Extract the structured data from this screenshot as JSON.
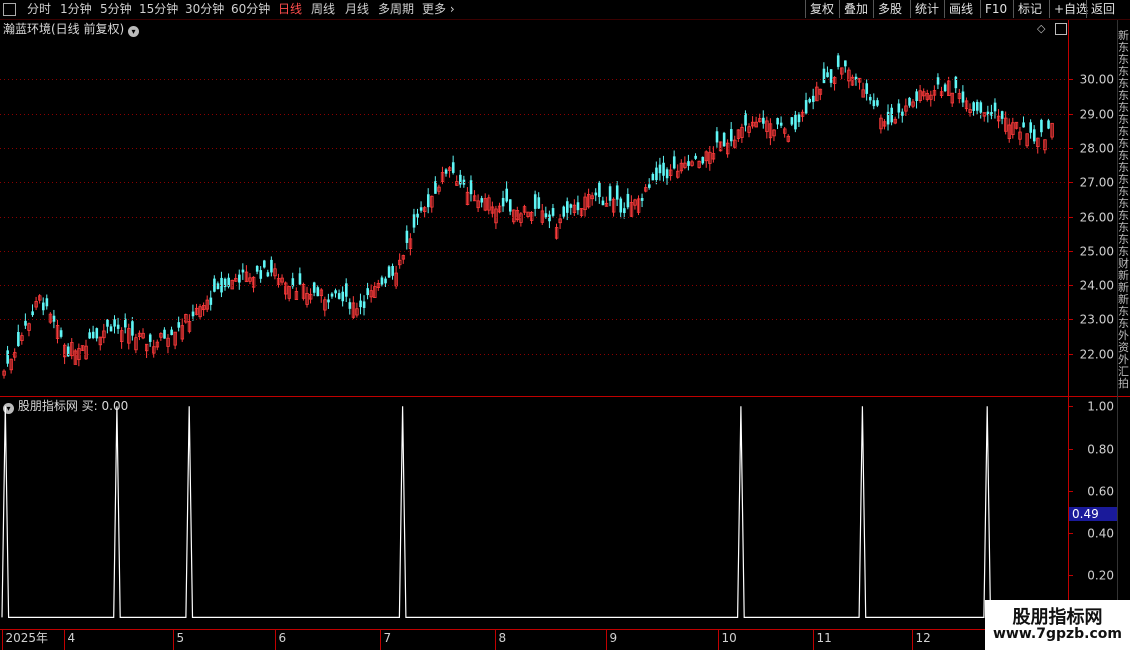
{
  "toolbar": {
    "periods": [
      {
        "label": "分时",
        "active": false
      },
      {
        "label": "1分钟",
        "active": false
      },
      {
        "label": "5分钟",
        "active": false
      },
      {
        "label": "15分钟",
        "active": false
      },
      {
        "label": "30分钟",
        "active": false
      },
      {
        "label": "60分钟",
        "active": false
      },
      {
        "label": "日线",
        "active": true
      },
      {
        "label": "周线",
        "active": false
      },
      {
        "label": "月线",
        "active": false
      },
      {
        "label": "多周期",
        "active": false
      },
      {
        "label": "更多",
        "active": false
      }
    ],
    "actions": [
      "复权",
      "叠加",
      "多股",
      "统计",
      "画线",
      "F10",
      "标记",
      "+自选",
      "返回"
    ]
  },
  "main_title": "瀚蓝环境(日线 前复权)",
  "indicator_title": "股朋指标网 买: 0.00",
  "side_glyphs": "新东东东东东东东东东东东东东东东东东东财新新新东东外资外汇拍",
  "watermark": {
    "line1": "股朋指标网",
    "line2": "www.7gpzb.com"
  },
  "colors": {
    "up": "#ff3b3b",
    "down": "#5ff5f5",
    "grid": "#8b0000",
    "axis": "#c00000",
    "indicator": "#ffffff",
    "cursor_box": "#1a1a9a"
  },
  "chart_data": [
    {
      "type": "candlestick",
      "title": "瀚蓝环境(日线 前复权)",
      "y_ticks": [
        30.0,
        29.0,
        28.0,
        27.0,
        26.0,
        25.0,
        24.0,
        23.0,
        22.0
      ],
      "ylim": [
        20.8,
        31.2
      ],
      "grid": true,
      "close_path_keypoints": [
        {
          "pos": 0,
          "value": 21.5
        },
        {
          "pos": 10,
          "value": 23.6
        },
        {
          "pos": 18,
          "value": 22.1
        },
        {
          "pos": 30,
          "value": 22.8
        },
        {
          "pos": 42,
          "value": 22.3
        },
        {
          "pos": 55,
          "value": 23.3
        },
        {
          "pos": 65,
          "value": 24.2
        },
        {
          "pos": 75,
          "value": 24.4
        },
        {
          "pos": 85,
          "value": 23.8
        },
        {
          "pos": 100,
          "value": 23.4
        },
        {
          "pos": 110,
          "value": 24.5
        },
        {
          "pos": 114,
          "value": 25.4
        },
        {
          "pos": 120,
          "value": 26.6
        },
        {
          "pos": 125,
          "value": 27.5
        },
        {
          "pos": 130,
          "value": 26.6
        },
        {
          "pos": 140,
          "value": 26.3
        },
        {
          "pos": 148,
          "value": 26.2
        },
        {
          "pos": 155,
          "value": 25.8
        },
        {
          "pos": 165,
          "value": 26.6
        },
        {
          "pos": 175,
          "value": 26.2
        },
        {
          "pos": 185,
          "value": 27.2
        },
        {
          "pos": 195,
          "value": 27.6
        },
        {
          "pos": 205,
          "value": 28.4
        },
        {
          "pos": 213,
          "value": 28.8
        },
        {
          "pos": 220,
          "value": 28.4
        },
        {
          "pos": 228,
          "value": 29.6
        },
        {
          "pos": 235,
          "value": 30.4
        },
        {
          "pos": 240,
          "value": 29.9
        },
        {
          "pos": 248,
          "value": 28.7
        },
        {
          "pos": 258,
          "value": 29.6
        },
        {
          "pos": 265,
          "value": 29.8
        },
        {
          "pos": 272,
          "value": 29.2
        },
        {
          "pos": 282,
          "value": 28.8
        },
        {
          "pos": 290,
          "value": 28.2
        },
        {
          "pos": 294,
          "value": 28.6
        }
      ],
      "bar_count": 295
    },
    {
      "type": "line",
      "title": "股朋指标网 买: 0.00",
      "series": [
        {
          "name": "买",
          "signal_positions": [
            1,
            35,
            57,
            122,
            225,
            262,
            300
          ],
          "signal_value": 1.0,
          "base_value": 0.0
        }
      ],
      "bar_count": 324,
      "y_ticks": [
        1.0,
        0.8,
        0.6,
        0.4,
        0.2
      ],
      "ylim": [
        -0.05,
        1.03
      ],
      "cursor_value": "0.49",
      "x_ticks": [
        {
          "label": "2025年",
          "pos": 0
        },
        {
          "label": "4",
          "pos": 19
        },
        {
          "label": "5",
          "pos": 52
        },
        {
          "label": "6",
          "pos": 83
        },
        {
          "label": "7",
          "pos": 115
        },
        {
          "label": "8",
          "pos": 150
        },
        {
          "label": "9",
          "pos": 184
        },
        {
          "label": "10",
          "pos": 218
        },
        {
          "label": "11",
          "pos": 247
        },
        {
          "label": "12",
          "pos": 277
        }
      ]
    }
  ]
}
